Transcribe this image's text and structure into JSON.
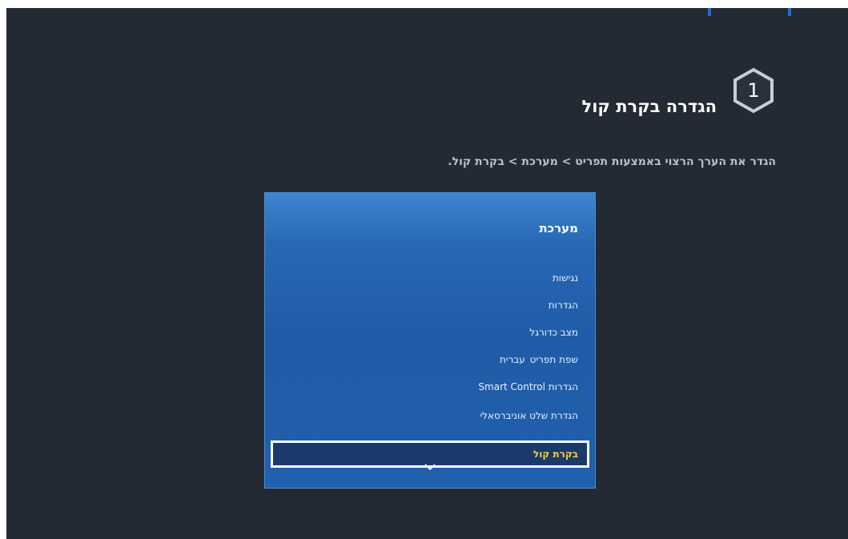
{
  "step": {
    "number": "1"
  },
  "title": "הגדרה בקרת קול",
  "instruction": "הגדר את הערך הרצוי באמצעות תפריט > מערכת > בקרת קול.",
  "menu": {
    "header": "מערכת",
    "items": [
      {
        "label": "נגישות",
        "value": ""
      },
      {
        "label": "הגדרות",
        "value": ""
      },
      {
        "label": "מצב כדורגל",
        "value": ""
      },
      {
        "label": "שפת תפריט",
        "value": "עברית"
      },
      {
        "label": "הגדרות Smart Control",
        "value": ""
      },
      {
        "label": "הגדרת שלט אוניברסאלי",
        "value": ""
      },
      {
        "label": "בקרת קול",
        "value": "",
        "selected": true
      }
    ],
    "scroll_icon": "chevron-down-icon"
  },
  "colors": {
    "background": "#242a33",
    "panel": "#2060ad",
    "selected_text": "#ffd23a",
    "accent": "#1f6fd6"
  }
}
